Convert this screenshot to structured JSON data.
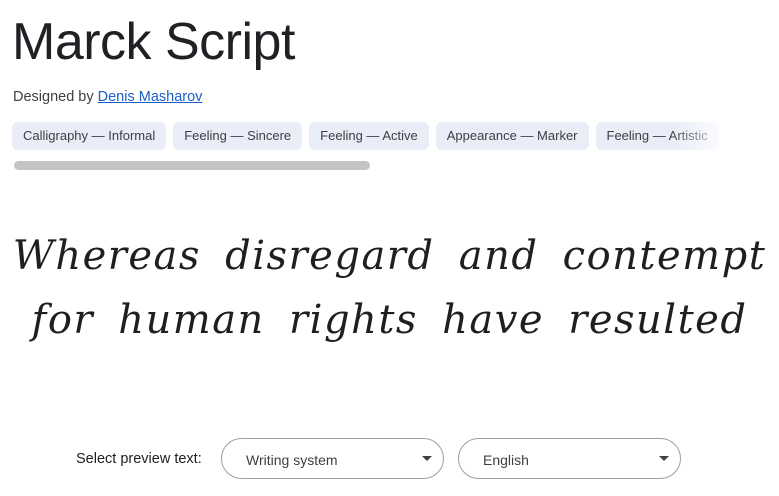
{
  "font": {
    "name": "Marck Script",
    "designed_by_prefix": "Designed by",
    "designer_name": "Denis Masharov"
  },
  "tags": [
    "Calligraphy — Informal",
    "Feeling — Sincere",
    "Feeling — Active",
    "Appearance — Marker",
    "Feeling — Artistic"
  ],
  "tags_scroll": {
    "visible_fraction": 0.49,
    "position": 0
  },
  "preview": {
    "lines": [
      "Whereas disregard and contempt",
      "for human rights have resulted"
    ]
  },
  "preview_controls": {
    "label": "Select preview text:",
    "writing_system": {
      "value": "Writing system",
      "icon": "dropdown-caret-icon"
    },
    "language": {
      "value": "English",
      "icon": "dropdown-caret-icon"
    }
  },
  "colors": {
    "link": "#1a5ec8",
    "tag_background": "#e8edf7",
    "text": "#202124"
  }
}
